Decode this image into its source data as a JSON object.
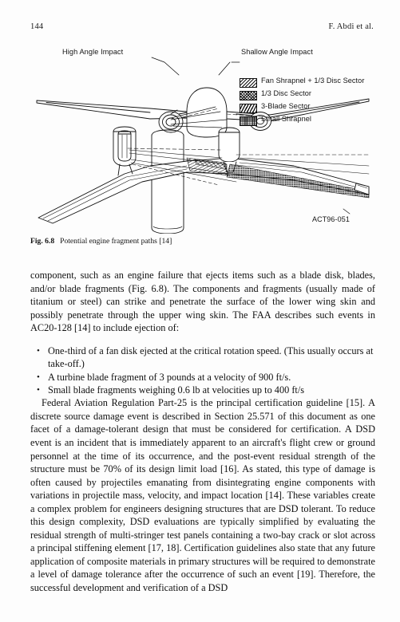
{
  "header": {
    "page_number": "144",
    "authors": "F. Abdi et al."
  },
  "figure": {
    "labels": {
      "high_angle": "High Angle Impact",
      "shallow_angle": "Shallow Angle Impact",
      "drawing_code": "ACT96-051"
    },
    "legend": [
      {
        "pattern": "diagonal-hatch",
        "label": "Fan Shrapnel + 1/3 Disc Sector"
      },
      {
        "pattern": "cross-hatch",
        "label": "1/3 Disc Sector"
      },
      {
        "pattern": "steep-hatch",
        "label": "3-Blade Sector"
      },
      {
        "pattern": "dot-grid",
        "label": "Small Shrapnel"
      }
    ],
    "caption_label": "Fig. 6.8",
    "caption_text": "Potential engine fragment paths [14]"
  },
  "body": {
    "paragraph_1": "component, such as an engine failure that ejects items such as a blade disk, blades, and/or blade fragments (Fig. 6.8). The components and fragments (usually made of titanium or steel) can strike and penetrate the surface of the lower wing skin and possibly penetrate through the upper wing skin. The FAA describes such events in AC20-128 [14] to include ejection of:",
    "bullets": [
      "One-third of a fan disk ejected at the critical rotation speed. (This usually occurs at take-off.)",
      "A turbine blade fragment of 3 pounds at a velocity of 900 ft/s.",
      "Small blade fragments weighing 0.6 lb at velocities up to 400 ft/s"
    ],
    "paragraph_2": "Federal Aviation Regulation Part-25 is the principal certification guideline [15]. A discrete source damage event is described in Section 25.571 of this document as one facet of a damage-tolerant design that must be considered for certification. A DSD event is an incident that is immediately apparent to an aircraft's flight crew or ground personnel at the time of its occurrence, and the post-event residual strength of the structure must be 70% of its design limit load [16]. As stated, this type of damage is often caused by projectiles emanating from disintegrating engine components with variations in projectile mass, velocity, and impact location [14]. These variables create a complex problem for engineers designing structures that are DSD tolerant. To reduce this design complexity, DSD evaluations are typically simplified by evaluating the residual strength of multi-stringer test panels containing a two-bay crack or slot across a principal stiffening element [17, 18]. Certification guidelines also state that any future application of composite materials in primary structures will be required to demonstrate a level of damage tolerance after the occurrence of such an event [19]. Therefore, the successful development and verification of a DSD"
  },
  "colors": {
    "text": "#111111",
    "page_background": "#fdfdfd",
    "line_art": "#111111"
  }
}
